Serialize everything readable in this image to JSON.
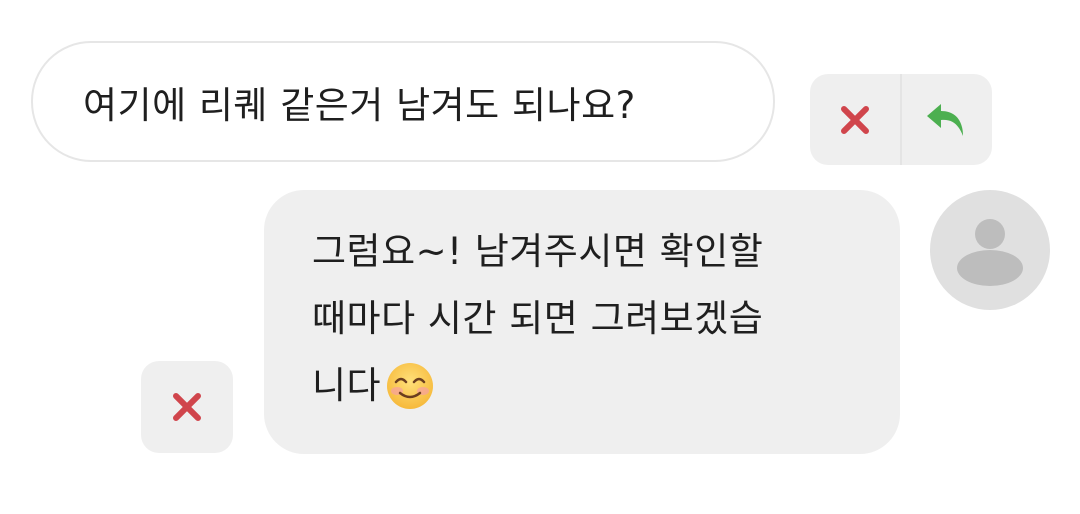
{
  "incoming_message": {
    "text": "여기에 리퀘 같은거 남겨도 되나요?"
  },
  "incoming_actions": {
    "delete_icon": "close-icon",
    "reply_icon": "reply-icon",
    "delete_color": "#d0454c",
    "reply_color": "#4caf50"
  },
  "outgoing_message": {
    "lines": [
      "그럼요~! 남겨주시면 확인할",
      "때마다 시간 되면 그려보겠습",
      "니다"
    ],
    "emoji": "smiling-face-with-smiling-eyes"
  },
  "outgoing_actions": {
    "delete_icon": "close-icon"
  },
  "avatar": {
    "icon": "default-user-avatar"
  }
}
